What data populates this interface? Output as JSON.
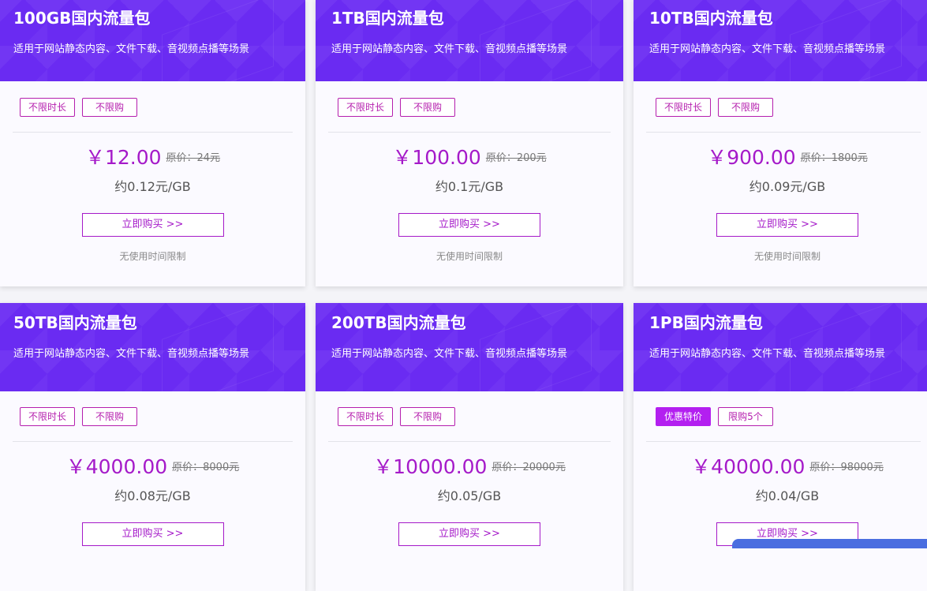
{
  "desc": "适用于网站静态内容、文件下载、音视频点播等场景",
  "buy_label": "立即购买 >>",
  "note": "无使用时间限制",
  "cards": [
    {
      "title": "100GB国内流量包",
      "tag1": "不限时长",
      "tag2": "不限购",
      "price": "￥12.00",
      "orig": "原价：24元",
      "unit": "约0.12元/GB"
    },
    {
      "title": "1TB国内流量包",
      "tag1": "不限时长",
      "tag2": "不限购",
      "price": "￥100.00",
      "orig": "原价：200元",
      "unit": "约0.1元/GB"
    },
    {
      "title": "10TB国内流量包",
      "tag1": "不限时长",
      "tag2": "不限购",
      "price": "￥900.00",
      "orig": "原价：1800元",
      "unit": "约0.09元/GB"
    },
    {
      "title": "50TB国内流量包",
      "tag1": "不限时长",
      "tag2": "不限购",
      "price": "￥4000.00",
      "orig": "原价：8000元",
      "unit": "约0.08元/GB"
    },
    {
      "title": "200TB国内流量包",
      "tag1": "不限时长",
      "tag2": "不限购",
      "price": "￥10000.00",
      "orig": "原价：20000元",
      "unit": "约0.05/GB"
    },
    {
      "title": "1PB国内流量包",
      "tag1": "优惠特价",
      "tag2": "限购5个",
      "price": "￥40000.00",
      "orig": "原价：98000元",
      "unit": "约0.04/GB"
    }
  ]
}
